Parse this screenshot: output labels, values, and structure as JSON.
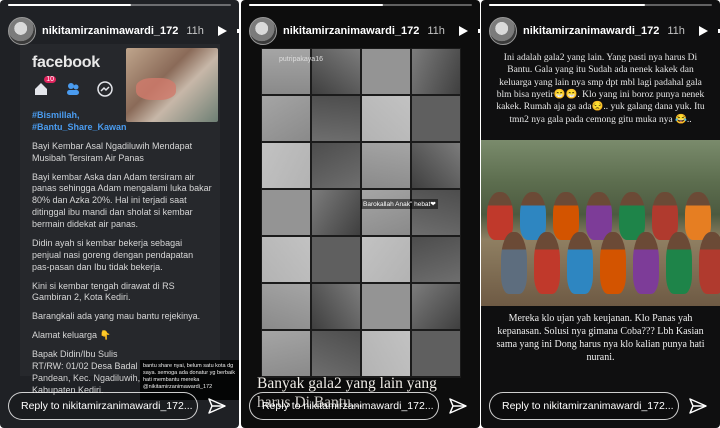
{
  "stories": [
    {
      "username": "nikitamirzanimawardi_172",
      "time": "11h",
      "progress": 0.55,
      "reply_placeholder": "Reply to nikitamirzanimawardi_172...",
      "fb": {
        "logo": "facebook",
        "badge": "10",
        "tags": "#Bismillah,\n#Bantu_Share_Kawan",
        "paragraphs": [
          "Bayi Kembar Asal Ngadiluwih Mendapat Musibah Tersiram Air Panas",
          "Bayi kembar Aska dan Adam tersiram air panas sehingga Adam mengalami luka bakar 80% dan Azka 20%. Hal ini terjadi saat ditinggal ibu mandi dan sholat si kembar bermain didekat air panas.",
          "Didin ayah si kembar bekerja sebagai penjual nasi goreng dengan pendapatan pas-pasan dan Ibu tidak bekerja.",
          "Kini si kembar tengah dirawat di RS Gambiran 2, Kota Kediri.",
          "Barangkali ada yang mau bantu rejekinya.",
          "Alamat keluarga 👇",
          "Bapak Didin/Ibu Sulis RT/RW: 01/02 Desa Badal Pandean, Kec. Ngadiluwih, Kabupaten Kediri."
        ],
        "overlay": "bantu share nyai, belum satu kota dg saya. semoga ada donatur yg berbaik hati membantu mereka @nikitamirzanimawardi_172"
      }
    },
    {
      "username": "nikitamirzanimawardi_172",
      "time": "11h",
      "progress": 0.6,
      "reply_placeholder": "Reply to nikitamirzanimawardi_172...",
      "collage_user": "putripakaya16",
      "brand_tag": "Barokallah Anak\" hebat❤",
      "caption": "Banyak gala2 yang lain yang harus Di Bantu..."
    },
    {
      "username": "nikitamirzanimawardi_172",
      "time": "11h",
      "progress": 0.7,
      "reply_placeholder": "Reply to nikitamirzanimawardi_172...",
      "top_text": "Ini adalah gala2 yang lain. Yang pasti nya harus Di Bantu. Gala yang itu Sudah ada nenek kakek dan keluarga yang lain nya smp dpt mbl lagi padahal gala blm bisa nyetir😁😁. Klo yang ini boroz punya nenek kakek. Rumah aja ga ada😒.. yuk galang dana yuk. Itu tmn2 nya gala pada cemong gitu muka nya 😂..",
      "bottom_text": "Mereka klo ujan yah keujanan. Klo Panas yah kepanasan. Solusi nya gimana Coba??? Lbh Kasian sama yang ini Dong harus nya klo kalian punya hati nurani."
    }
  ],
  "colors": {
    "accent_blue": "#4a9cf0",
    "badge_red": "#e0245e"
  }
}
